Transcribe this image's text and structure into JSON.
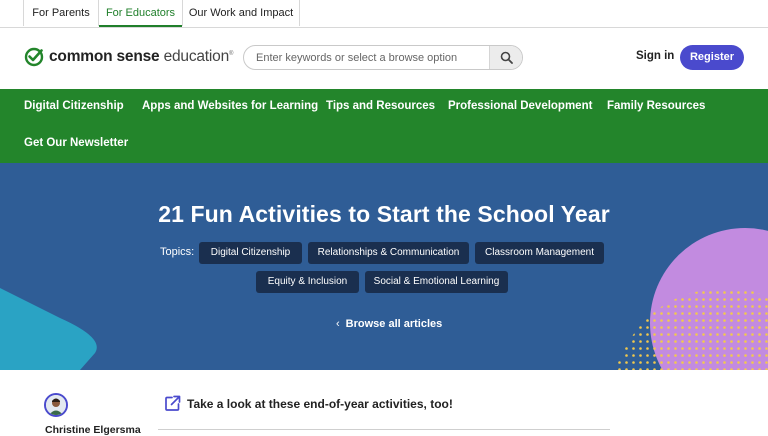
{
  "audience_tabs": [
    "For Parents",
    "For Educators",
    "Our Work and Impact"
  ],
  "logo": {
    "bold": "common sense",
    "light": "education",
    "mark": "®"
  },
  "search": {
    "placeholder": "Enter keywords or select a browse option",
    "icon": "search-icon"
  },
  "header": {
    "signin": "Sign in",
    "register": "Register"
  },
  "nav": [
    "Digital Citizenship",
    "Apps and Websites for Learning",
    "Tips and Resources",
    "Professional Development",
    "Family Resources",
    "Get Our Newsletter"
  ],
  "hero": {
    "title": "21 Fun Activities to Start the School Year",
    "topics_label": "Topics:",
    "topics": [
      "Digital Citizenship",
      "Relationships & Communication",
      "Classroom Management",
      "Equity & Inclusion",
      "Social & Emotional Learning"
    ],
    "browse": "Browse all articles"
  },
  "author": {
    "name": "Christine Elgersma"
  },
  "link": {
    "text": "Take a look at these end-of-year activities, too!",
    "icon": "external-link-icon"
  },
  "colors": {
    "green": "#23852b",
    "blue_hero": "#2f5d96",
    "register": "#4a4acd",
    "chip": "#1a2f4f"
  }
}
